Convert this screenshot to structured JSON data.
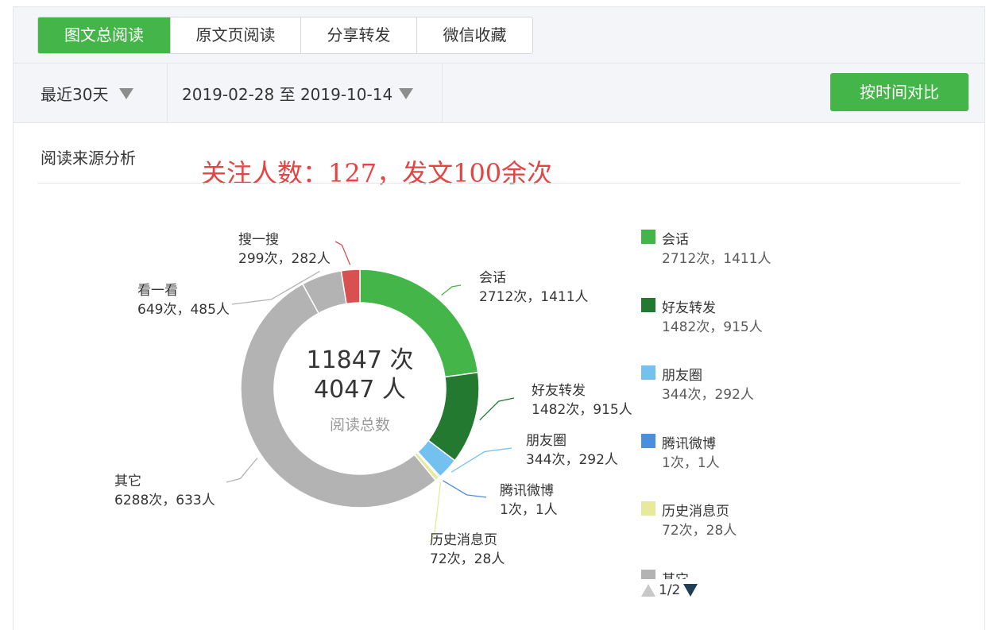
{
  "tabs": [
    {
      "label": "图文总阅读",
      "active": true
    },
    {
      "label": "原文页阅读",
      "active": false
    },
    {
      "label": "分享转发",
      "active": false
    },
    {
      "label": "微信收藏",
      "active": false
    }
  ],
  "filters": {
    "period": "最近30天",
    "date_range": "2019-02-28 至 2019-10-14",
    "compare_button": "按时间对比"
  },
  "section_title": "阅读来源分析",
  "annotation": "关注人数：127，发文100余次",
  "colors": {
    "accent": "#44b549",
    "annotation": "#e54444"
  },
  "chart_data": {
    "type": "pie",
    "donut": true,
    "center": {
      "total_reads": "11847 次",
      "total_people": "4047 人",
      "caption": "阅读总数"
    },
    "slices": [
      {
        "name": "会话",
        "reads": 2712,
        "people": 1411,
        "label": "2712次，1411人",
        "color": "#44b549"
      },
      {
        "name": "好友转发",
        "reads": 1482,
        "people": 915,
        "label": "1482次，915人",
        "color": "#22792f"
      },
      {
        "name": "朋友圈",
        "reads": 344,
        "people": 292,
        "label": "344次，292人",
        "color": "#74c1f0"
      },
      {
        "name": "腾讯微博",
        "reads": 1,
        "people": 1,
        "label": "1次，1人",
        "color": "#4a8ee0"
      },
      {
        "name": "历史消息页",
        "reads": 72,
        "people": 28,
        "label": "72次，28人",
        "color": "#e6ea9a"
      },
      {
        "name": "其它",
        "reads": 6288,
        "people": 633,
        "label": "6288次，633人",
        "color": "#b3b3b3"
      },
      {
        "name": "看一看",
        "reads": 649,
        "people": 485,
        "label": "649次，485人",
        "color": "#b3b3b3"
      },
      {
        "name": "搜一搜",
        "reads": 299,
        "people": 282,
        "label": "299次，282人",
        "color": "#d95050"
      }
    ],
    "legend_placement": "right",
    "legend_visible_names": [
      "会话",
      "好友转发",
      "朋友圈",
      "腾讯微博",
      "历史消息页",
      "其它"
    ]
  },
  "legend_pager": {
    "page": "1/2"
  }
}
